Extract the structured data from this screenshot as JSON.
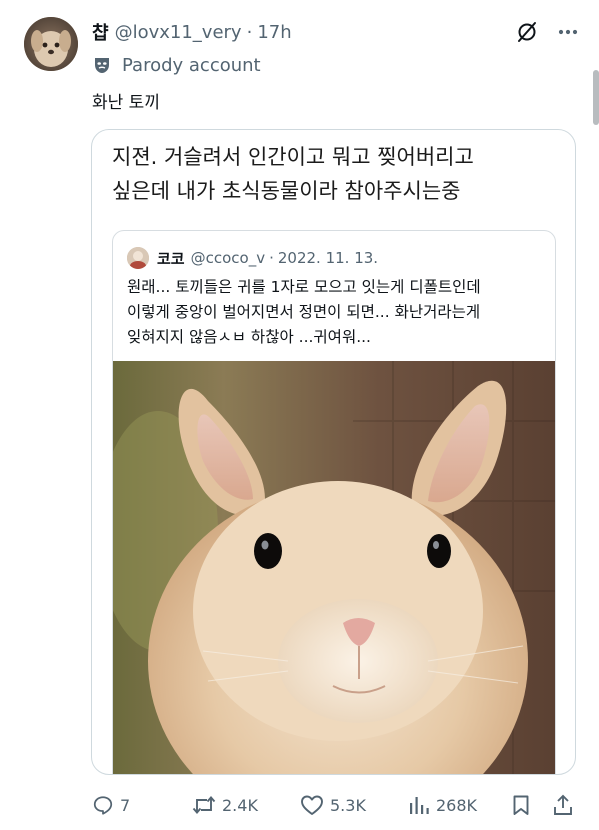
{
  "author": {
    "display_name": "챱",
    "handle": "@lovx11_very",
    "separator": "·",
    "time": "17h",
    "badge_label": "Parody account"
  },
  "tweet": {
    "text": "화난 토끼"
  },
  "card": {
    "line1": "지젼. 거슬려서 인간이고 뭐고 찢어버리고",
    "line2": "싶은데 내가 초식동물이라 참아주시는중"
  },
  "quoted": {
    "name": "코코",
    "handle": "@ccoco_v",
    "separator": "·",
    "date": "2022. 11. 13.",
    "line1": "원래... 토끼들은 귀를 1자로 모으고 잇는게 디폴트인데",
    "line2": "이렇게 중앙이 벌어지면서 정면이 되면... 화난거라는게",
    "line3": "잊혀지지 않음ㅅㅂ 하찮아 ...귀여워..."
  },
  "actions": {
    "replies": "7",
    "reposts": "2.4K",
    "likes": "5.3K",
    "views": "268K"
  },
  "icons": {
    "grok": "grok-icon",
    "more": "more-icon",
    "parody": "mask-icon",
    "reply": "reply-icon",
    "repost": "repost-icon",
    "like": "heart-icon",
    "views": "views-icon",
    "bookmark": "bookmark-icon",
    "share": "share-icon"
  },
  "colors": {
    "text": "#0f1419",
    "secondary": "#536471",
    "border": "#cfd9de"
  }
}
